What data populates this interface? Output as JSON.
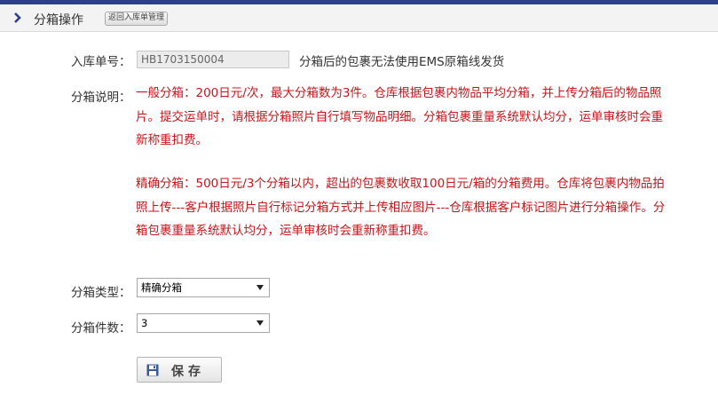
{
  "header": {
    "title": "分箱操作",
    "back_label": "返回入库单管理"
  },
  "form": {
    "order_label": "入库单号：",
    "order_value": "HB1703150004",
    "order_note": "分箱后的包裹无法使用EMS原箱线发货",
    "desc_label": "分箱说明：",
    "desc_general": "一般分箱：200日元/次，最大分箱数为3件。仓库根据包裹内物品平均分箱，并上传分箱后的物品照片。提交运单时，请根据分箱照片自行填写物品明细。分箱包裹重量系统默认均分，运单审核时会重新称重扣费。",
    "desc_precise": "精确分箱：500日元/3个分箱以内，超出的包裹数收取100日元/箱的分箱费用。仓库将包裹内物品拍照上传---客户根据照片自行标记分箱方式并上传相应图片---仓库根据客户标记图片进行分箱操作。分箱包裹重量系统默认均分，运单审核时会重新称重扣费。",
    "type_label": "分箱类型：",
    "type_value": "精确分箱",
    "count_label": "分箱件数：",
    "count_value": "3",
    "save_label": "保存"
  },
  "colors": {
    "accent_bar": "#2d3f8a",
    "warning_text": "#c8151b"
  }
}
